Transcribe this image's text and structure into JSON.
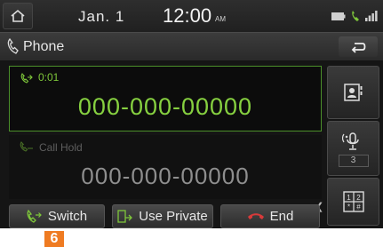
{
  "status_bar": {
    "date": "Jan. 1",
    "time": "12:00",
    "ampm": "AM"
  },
  "title_bar": {
    "title": "Phone"
  },
  "active_call": {
    "duration": "0:01",
    "number": "000-000-00000"
  },
  "held_call": {
    "label": "Call Hold",
    "number": "000-000-00000"
  },
  "side_panel": {
    "volume_value": "3"
  },
  "bottom_bar": {
    "switch_label": "Switch",
    "use_private_label": "Use Private",
    "end_label": "End"
  },
  "callout": {
    "number": "6"
  },
  "colors": {
    "active_green": "#86d040",
    "end_red": "#d83a3a",
    "callout_orange": "#ef7b22"
  },
  "icons": [
    "home-icon",
    "battery-icon",
    "signal-icon",
    "phone-icon",
    "back-icon",
    "contacts-icon",
    "mute-mic-icon",
    "keypad-icon",
    "switch-call-icon",
    "use-private-icon",
    "end-call-icon",
    "chevron-left-icon"
  ]
}
